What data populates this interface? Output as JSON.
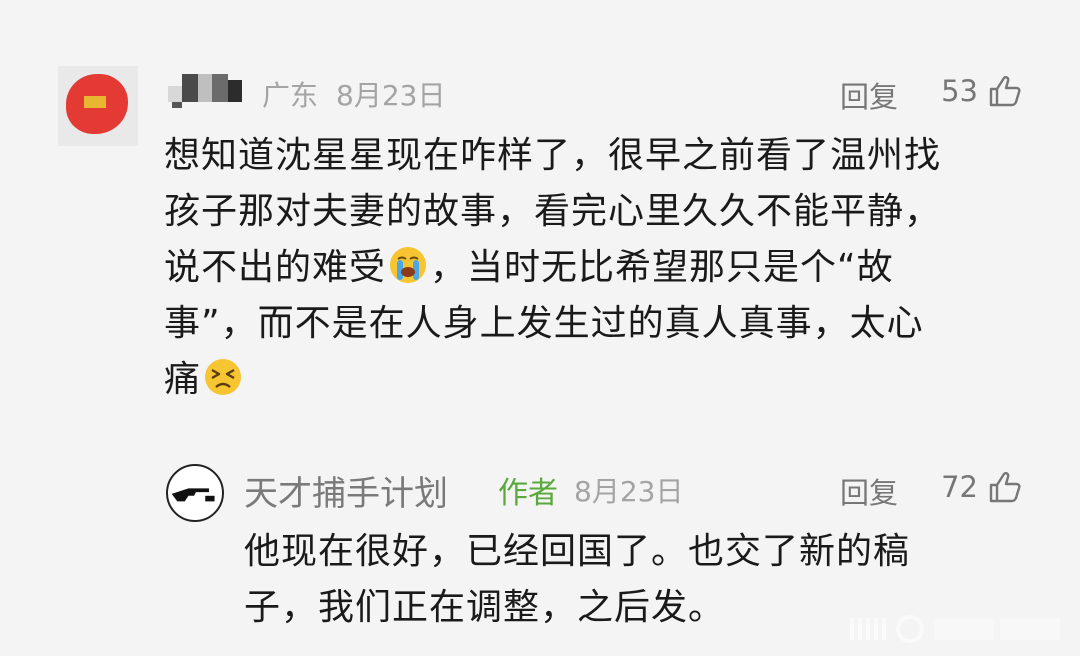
{
  "comment": {
    "location": "广东",
    "date": "8月23日",
    "reply_label": "回复",
    "likes": "53",
    "lines": [
      "想知道沈星星现在咋样了，很早之前看了温州找",
      "孩子那对夫妻的故事，看完心里久久不能平静，",
      "说不出的难受",
      "，当时无比希望那只是个“故",
      "事”，而不是在人身上发生过的真人真事，太心",
      "痛"
    ],
    "emojis": [
      "crying-face",
      "persevering-face"
    ]
  },
  "reply": {
    "username": "天才捕手计划",
    "badge": "作者",
    "date": "8月23日",
    "reply_label": "回复",
    "likes": "72",
    "lines": [
      "他现在很好，已经回国了。也交了新的稿",
      "子，我们正在调整，之后发。"
    ]
  },
  "colors": {
    "background": "#f4f4f4",
    "text": "#1a1a1a",
    "meta": "#a4a4a4",
    "author_badge": "#5aa93c"
  }
}
